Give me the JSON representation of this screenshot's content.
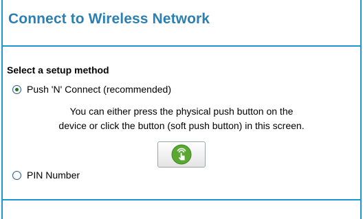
{
  "header": {
    "title": "Connect to Wireless Network"
  },
  "setup": {
    "section_label": "Select a setup method",
    "options": [
      {
        "label": "Push 'N' Connect (recommended)",
        "selected": true
      },
      {
        "label": "PIN Number",
        "selected": false
      }
    ],
    "description": [
      "You can either press the physical push button on the",
      "device or click the button (soft push button) in this screen."
    ],
    "push_button_icon": "wps-push-hand-icon"
  },
  "colors": {
    "accent": "#1a97cc",
    "title": "#2c7fb3",
    "button_icon": "#5aa832"
  }
}
